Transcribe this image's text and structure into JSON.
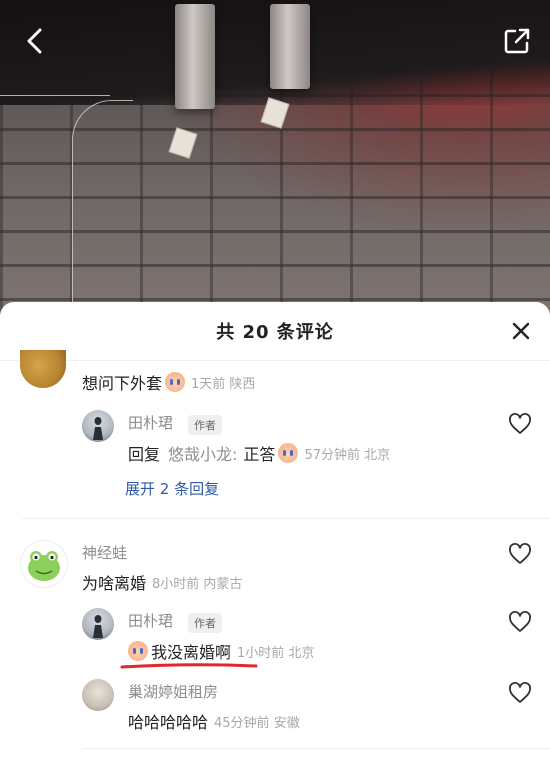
{
  "sheet": {
    "title": "共 20 条评论"
  },
  "comments": [
    {
      "text": "想问下外套",
      "has_emoji": true,
      "meta": "1天前 陕西",
      "reply": {
        "name": "田朴珺",
        "badge": "作者",
        "prefix": "回复",
        "target": "悠哉小龙:",
        "text": "正答",
        "meta": "57分钟前 北京"
      },
      "expand_label": "展开 2 条回复"
    },
    {
      "name": "神经蛙",
      "text": "为啥离婚",
      "meta": "8小时前 内蒙古",
      "replies": [
        {
          "name": "田朴珺",
          "badge": "作者",
          "text": "我没离婚啊",
          "meta": "1小时前 北京"
        },
        {
          "name": "巢湖婷姐租房",
          "text": "哈哈哈哈哈",
          "meta": "45分钟前 安徽"
        }
      ]
    }
  ],
  "colors": {
    "link": "#2d5aa5",
    "meta": "#a8a8a8",
    "underline_mark": "#e0262e"
  },
  "icons": [
    "back-icon",
    "share-icon",
    "close-icon",
    "heart-icon"
  ]
}
